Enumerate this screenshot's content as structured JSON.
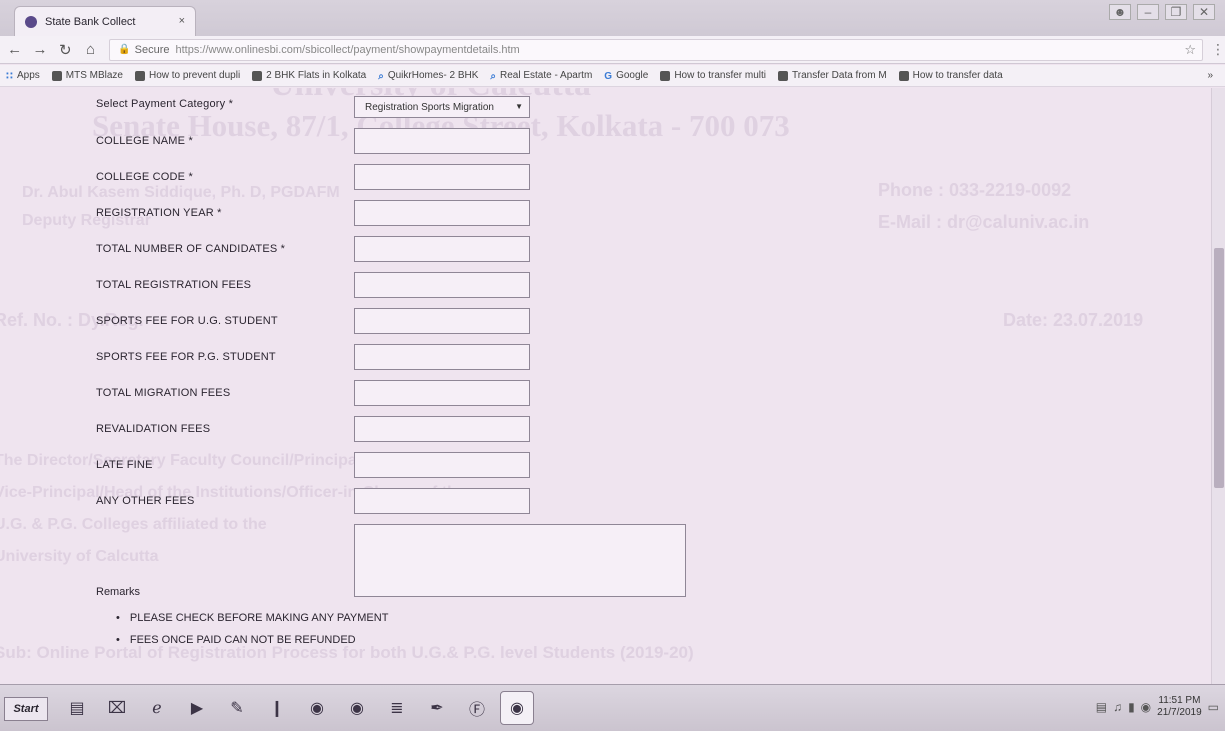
{
  "browser": {
    "tab_title": "State Bank Collect",
    "tab_close": "×",
    "address": {
      "secure_label": "Secure",
      "url": "https://www.onlinesbi.com/sbicollect/payment/showpaymentdetails.htm"
    },
    "bookmarks": [
      {
        "label": "Apps",
        "icon": "apps-grid-icon"
      },
      {
        "label": "MTS MBlaze",
        "icon": "bookmark-icon"
      },
      {
        "label": "How to prevent dupli",
        "icon": "video-icon"
      },
      {
        "label": "2 BHK Flats in Kolkata",
        "icon": "bookmark-icon"
      },
      {
        "label": "QuikrHomes- 2 BHK",
        "icon": "search-icon"
      },
      {
        "label": "Real Estate - Apartm",
        "icon": "search-icon"
      },
      {
        "label": "Google",
        "icon": "google-icon"
      },
      {
        "label": "How to transfer multi",
        "icon": "video-icon"
      },
      {
        "label": "Transfer Data from M",
        "icon": "video-icon"
      },
      {
        "label": "How to transfer data",
        "icon": "video-icon"
      }
    ],
    "bookmarks_more": "»"
  },
  "form": {
    "payment_category": {
      "label": "Select Payment Category *",
      "value": "Registration Sports Migration"
    },
    "fields": [
      {
        "label": "COLLEGE NAME *"
      },
      {
        "label": "COLLEGE CODE *"
      },
      {
        "label": "REGISTRATION YEAR *"
      },
      {
        "label": "TOTAL NUMBER OF CANDIDATES *"
      },
      {
        "label": "TOTAL REGISTRATION FEES"
      },
      {
        "label": "SPORTS FEE FOR U.G. STUDENT"
      },
      {
        "label": "SPORTS FEE FOR P.G. STUDENT"
      },
      {
        "label": "TOTAL MIGRATION FEES"
      },
      {
        "label": "REVALIDATION FEES"
      },
      {
        "label": "LATE FINE"
      },
      {
        "label": "ANY OTHER FEES"
      }
    ],
    "remarks_label": "Remarks",
    "notes": [
      "PLEASE CHECK BEFORE MAKING ANY PAYMENT",
      "FEES ONCE PAID CAN NOT BE REFUNDED"
    ]
  },
  "watermark": {
    "line1": "University of Calcutta",
    "line2": "Senate House, 87/1, College Street, Kolkata - 700 073",
    "line3": "Dr. Abul Kasem Siddique, Ph. D, PGDAFM",
    "line4": "Deputy Registrar",
    "line5": "Phone : 033-2219-0092",
    "line6": "E-Mail : dr@caluniv.ac.in",
    "line7": "Ref. No. : Dy.Reg.",
    "line8": "Date: 23.07.2019",
    "line9": "The Director/Secretary Faculty Council/Principal/Teacher-in-Charge",
    "line10": "Vice-Principal/Head of the Institutions/Officer-in-Charge of the",
    "line11": "U.G. & P.G. Colleges affiliated to the",
    "line12": "University of Calcutta",
    "line13": "Sub: Online Portal of Registration Process for both U.G.& P.G. level Students (2019-20)"
  },
  "taskbar": {
    "start_label": "Start",
    "apps": [
      {
        "icon": "folder-icon"
      },
      {
        "icon": "excel-icon"
      },
      {
        "icon": "internet-explorer-icon"
      },
      {
        "icon": "media-player-icon"
      },
      {
        "icon": "paint-icon"
      },
      {
        "icon": "usb-icon"
      },
      {
        "icon": "chrome-icon"
      },
      {
        "icon": "chrome-icon"
      },
      {
        "icon": "notepad-icon"
      },
      {
        "icon": "pen-icon"
      },
      {
        "icon": "foxit-reader-icon"
      },
      {
        "icon": "chrome-icon",
        "active": true
      }
    ],
    "clock_time": "11:51 PM",
    "clock_date": "21/7/2019"
  }
}
